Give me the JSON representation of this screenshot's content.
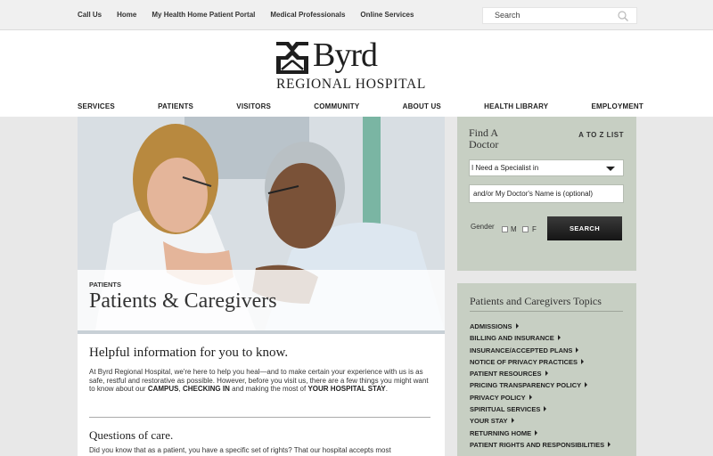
{
  "topbar": {
    "links": [
      "Call Us",
      "Home",
      "My Health Home Patient Portal",
      "Medical Professionals",
      "Online Services"
    ],
    "search_placeholder": "Search"
  },
  "header": {
    "logo_name": "Byrd",
    "logo_sub": "REGIONAL HOSPITAL",
    "nav": [
      "SERVICES",
      "PATIENTS",
      "VISITORS",
      "COMMUNITY",
      "ABOUT US",
      "HEALTH LIBRARY",
      "EMPLOYMENT"
    ]
  },
  "hero": {
    "kicker": "PATIENTS",
    "title": "Patients & Caregivers"
  },
  "content": {
    "heading": "Helpful information for you to know.",
    "para_intro": "At Byrd Regional Hospital, we're here to help you heal—and to make certain your experience with us is as safe, restful and restorative as possible. However, before you visit us, there are a few things you might want to know about our ",
    "para_link1": "CAMPUS",
    "para_sep1": ", ",
    "para_link2": "CHECKING IN",
    "para_mid": " and making the most of ",
    "para_link3": "YOUR HOSPITAL STAY",
    "para_end": ".",
    "heading2": "Questions of care.",
    "para2": "Did you know that as a patient, you have a specific set of rights? That our hospital accepts most"
  },
  "find_doctor": {
    "title": "Find A Doctor",
    "a_to_z": "A TO Z LIST",
    "specialist_value": "I Need a Specialist in",
    "name_placeholder": "and/or My Doctor's Name is (optional)",
    "gender_label": "Gender",
    "gender_m": "M",
    "gender_f": "F",
    "search_button": "SEARCH"
  },
  "topics": {
    "title": "Patients and Caregivers Topics",
    "items": [
      "ADMISSIONS",
      "BILLING AND INSURANCE",
      "INSURANCE/ACCEPTED PLANS",
      "NOTICE OF PRIVACY PRACTICES",
      "PATIENT RESOURCES",
      "PRICING TRANSPARENCY POLICY",
      "PRIVACY POLICY",
      "SPIRITUAL SERVICES",
      "YOUR STAY",
      "RETURNING HOME",
      "PATIENT RIGHTS AND RESPONSIBILITIES"
    ]
  }
}
